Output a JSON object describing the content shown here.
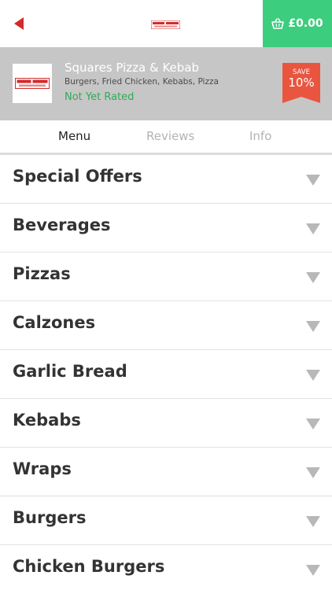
{
  "header": {
    "back_icon": "back-arrow-icon",
    "logo_alt": "Squares Pizza & Kebab logo",
    "basket": {
      "icon": "basket-icon",
      "amount": "£0.00",
      "color": "#3ccd7e"
    }
  },
  "restaurant": {
    "name": "Squares Pizza & Kebab",
    "cuisine": "Burgers, Fried Chicken, Kebabs, Pizza",
    "rating_text": "Not Yet Rated",
    "offer": {
      "label": "SAVE",
      "value": "10%",
      "color": "#e9553f"
    },
    "header_bg": "#c6c6c6"
  },
  "tabs": [
    {
      "label": "Menu",
      "active": true
    },
    {
      "label": "Reviews",
      "active": false
    },
    {
      "label": "Info",
      "active": false
    }
  ],
  "menu": {
    "chevron_icon": "chevron-down-icon",
    "categories": [
      {
        "label": "Special Offers"
      },
      {
        "label": "Beverages"
      },
      {
        "label": "Pizzas"
      },
      {
        "label": "Calzones"
      },
      {
        "label": "Garlic Bread"
      },
      {
        "label": "Kebabs"
      },
      {
        "label": "Wraps"
      },
      {
        "label": "Burgers"
      },
      {
        "label": "Chicken Burgers"
      }
    ]
  }
}
